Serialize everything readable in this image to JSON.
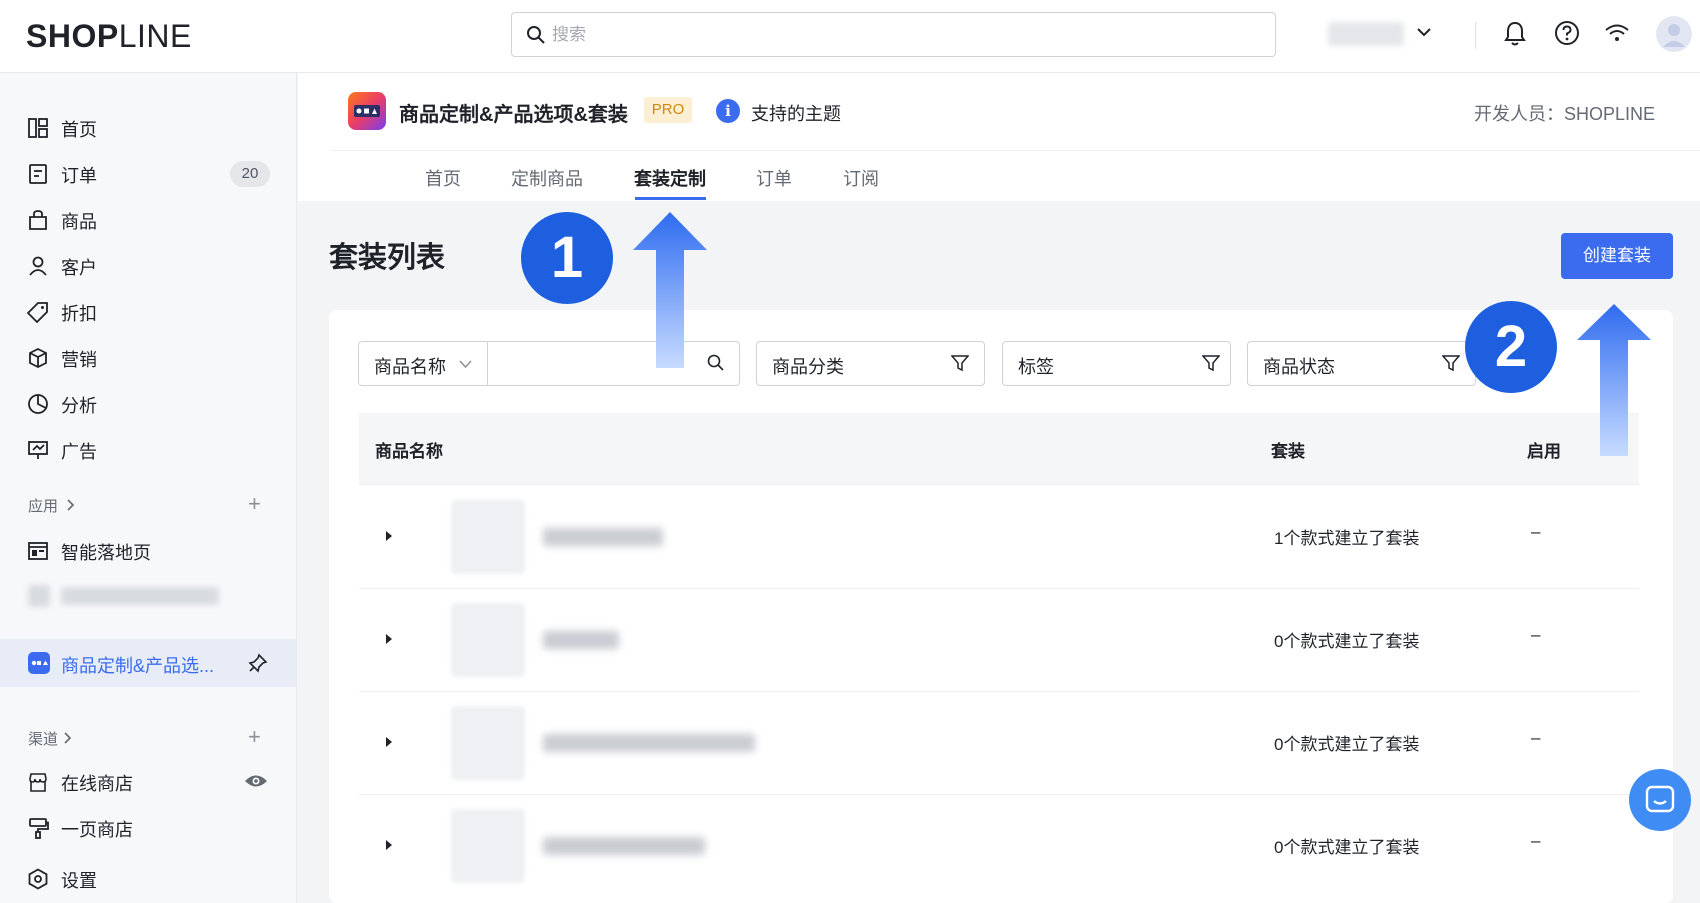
{
  "topbar": {
    "logo_bold": "SHOP",
    "logo_thin": "LINE",
    "search_placeholder": "搜索"
  },
  "sidebar": {
    "items": [
      {
        "label": "首页",
        "icon": "dashboard-icon"
      },
      {
        "label": "订单",
        "icon": "order-icon",
        "badge": "20"
      },
      {
        "label": "商品",
        "icon": "bag-icon"
      },
      {
        "label": "客户",
        "icon": "user-icon"
      },
      {
        "label": "折扣",
        "icon": "tag-icon"
      },
      {
        "label": "营销",
        "icon": "box-icon"
      },
      {
        "label": "分析",
        "icon": "pie-chart-icon"
      },
      {
        "label": "广告",
        "icon": "ad-monitor-icon"
      }
    ],
    "apps_section": "应用",
    "apps": [
      {
        "label": "智能落地页",
        "icon": "landing-page-icon"
      }
    ],
    "active_app": "商品定制&产品选...",
    "channels_section": "渠道",
    "channels": [
      {
        "label": "在线商店",
        "icon": "store-icon"
      },
      {
        "label": "一页商店",
        "icon": "brush-icon"
      }
    ],
    "settings": "设置"
  },
  "app_header": {
    "title": "商品定制&产品选项&套装",
    "badge": "PRO",
    "supported_themes": "支持的主题",
    "developer": "开发人员：SHOPLINE"
  },
  "tabs": [
    "首页",
    "定制商品",
    "套装定制",
    "订单",
    "订阅"
  ],
  "active_tab": "套装定制",
  "page": {
    "title": "套装列表",
    "create_button": "创建套装"
  },
  "filters": {
    "name_select": "商品名称",
    "category": "商品分类",
    "tags": "标签",
    "status": "商品状态"
  },
  "table": {
    "columns": [
      "商品名称",
      "套装",
      "启用"
    ],
    "rows": [
      {
        "bundle": "1个款式建立了套装",
        "enabled": "–"
      },
      {
        "bundle": "0个款式建立了套装",
        "enabled": "–"
      },
      {
        "bundle": "0个款式建立了套装",
        "enabled": "–"
      },
      {
        "bundle": "0个款式建立了套装",
        "enabled": "–"
      }
    ]
  },
  "callouts": [
    "1",
    "2"
  ],
  "colors": {
    "accent": "#3b6cf0",
    "callout": "#1e5fe0",
    "pro_bg": "#fdefd4",
    "pro_text": "#d08712"
  }
}
